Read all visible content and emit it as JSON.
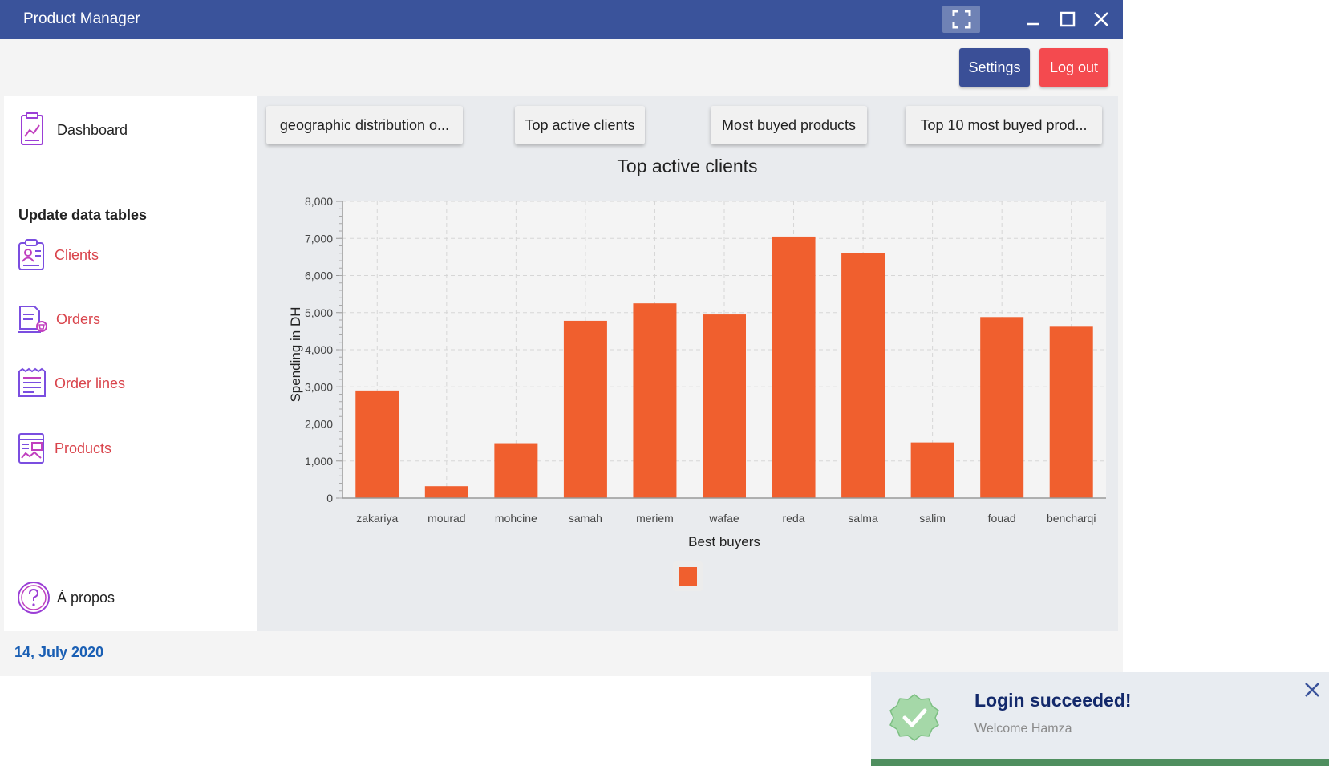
{
  "window": {
    "title": "Product Manager"
  },
  "header": {
    "settings_label": "Settings",
    "logout_label": "Log out"
  },
  "sidebar": {
    "dashboard_label": "Dashboard",
    "section_title": "Update data tables",
    "items": [
      {
        "label": "Clients",
        "icon": "clients-icon"
      },
      {
        "label": "Orders",
        "icon": "orders-icon"
      },
      {
        "label": "Order lines",
        "icon": "order-lines-icon"
      },
      {
        "label": "Products",
        "icon": "products-icon"
      }
    ],
    "about_label": "À propos"
  },
  "footer": {
    "date": "14, July 2020"
  },
  "tabs": [
    {
      "label": "geographic distribution o..."
    },
    {
      "label": "Top active clients"
    },
    {
      "label": "Most buyed products"
    },
    {
      "label": "Top 10 most buyed prod..."
    }
  ],
  "colors": {
    "titlebar": "#3a539b",
    "accent": "#3a4f97",
    "logout": "#f44a4f",
    "nav_text": "#d9434b",
    "bar": "#f05f2e",
    "date": "#1a5fb4"
  },
  "chart_data": {
    "type": "bar",
    "title": "Top active clients",
    "xlabel": "Best buyers",
    "ylabel": "Spending in DH",
    "categories": [
      "zakariya",
      "mourad",
      "mohcine",
      "samah",
      "meriem",
      "wafae",
      "reda",
      "salma",
      "salim",
      "fouad",
      "bencharqi"
    ],
    "values": [
      2900,
      320,
      1480,
      4780,
      5250,
      4950,
      7050,
      6600,
      1500,
      4880,
      4620
    ],
    "ylim": [
      0,
      8000
    ],
    "yticks": [
      "0",
      "1,000",
      "2,000",
      "3,000",
      "4,000",
      "5,000",
      "6,000",
      "7,000",
      "8,000"
    ],
    "grid": true,
    "legend": "bottom"
  },
  "toast": {
    "title": "Login succeeded!",
    "message": "Welcome Hamza"
  }
}
